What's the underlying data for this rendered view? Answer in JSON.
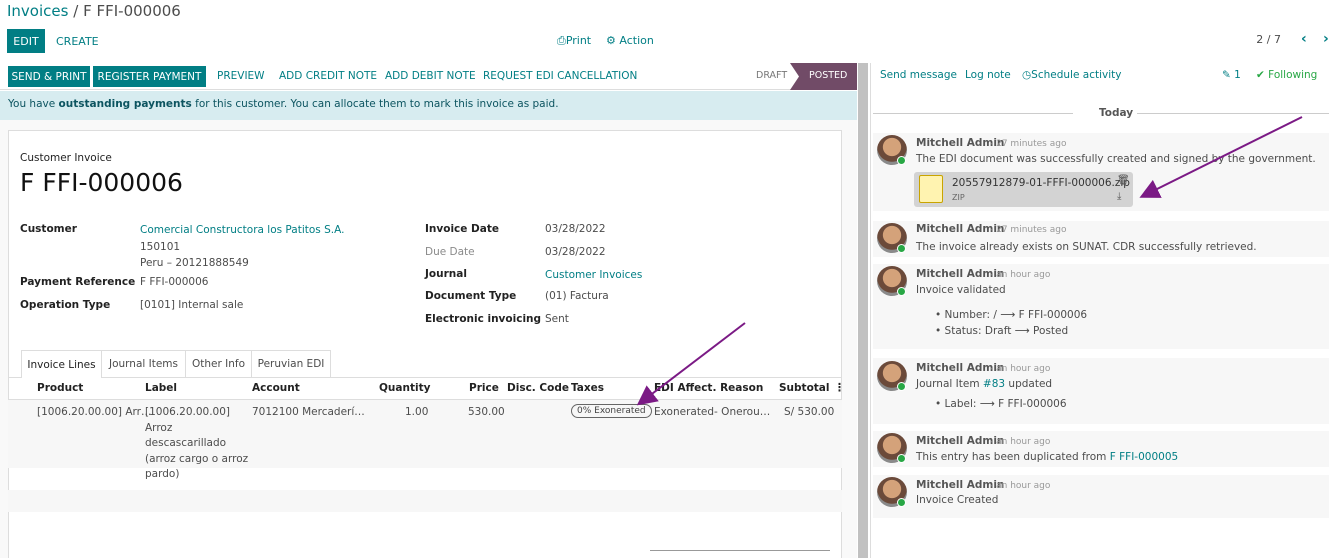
{
  "breadcrumb": {
    "parent": "Invoices",
    "separator": "/",
    "current": "F FFI-000006"
  },
  "toolbar": {
    "edit": "EDIT",
    "create": "CREATE",
    "print": "Print",
    "action": "Action",
    "pager": "2 / 7"
  },
  "actions": {
    "send_print": "SEND & PRINT",
    "register_payment": "REGISTER PAYMENT",
    "preview": "PREVIEW",
    "add_credit_note": "ADD CREDIT NOTE",
    "add_debit_note": "ADD DEBIT NOTE",
    "request_edi_cancel": "REQUEST EDI CANCELLATION"
  },
  "status": {
    "draft": "DRAFT",
    "posted": "POSTED"
  },
  "alert": {
    "prefix": "You have ",
    "bold": "outstanding payments",
    "suffix": " for this customer. You can allocate them to mark this invoice as paid."
  },
  "invoice": {
    "type": "Customer Invoice",
    "number": "F FFI-000006",
    "customer_label": "Customer",
    "customer_name": "Comercial Constructora los Patitos S.A.",
    "customer_line2": "150101",
    "customer_line3": "Peru – 20121888549",
    "payment_ref_label": "Payment Reference",
    "payment_ref": "F FFI-000006",
    "operation_type_label": "Operation Type",
    "operation_type": "[0101] Internal sale",
    "invoice_date_label": "Invoice Date",
    "invoice_date": "03/28/2022",
    "due_date_label": "Due Date",
    "due_date": "03/28/2022",
    "journal_label": "Journal",
    "journal": "Customer Invoices",
    "doc_type_label": "Document Type",
    "doc_type": "(01) Factura",
    "einvoicing_label": "Electronic invoicing",
    "einvoicing": "Sent"
  },
  "tabs": [
    "Invoice Lines",
    "Journal Items",
    "Other Info",
    "Peruvian EDI"
  ],
  "lines": {
    "headers": {
      "product": "Product",
      "label": "Label",
      "account": "Account",
      "quantity": "Quantity",
      "price": "Price",
      "disc": "Disc. Code",
      "taxes": "Taxes",
      "edi": "EDI Affect. Reason",
      "subtotal": "Subtotal"
    },
    "row": {
      "product": "[1006.20.00.00] Arr…",
      "label1": "[1006.20.00.00] Arroz",
      "label2": "descascarillado",
      "label3": "(arroz cargo o arroz",
      "label4": "pardo)",
      "account": "7012100 Mercaderí…",
      "quantity": "1.00",
      "price": "530.00",
      "tax": "0% Exonerated",
      "edi": "Exonerated- Onerou…",
      "subtotal": "S/ 530.00"
    }
  },
  "chatter": {
    "send_message": "Send message",
    "log_note": "Log note",
    "schedule": "Schedule activity",
    "attachments": "1",
    "following": "Following",
    "today": "Today",
    "messages": [
      {
        "author": "Mitchell Admin",
        "time": "- 27 minutes ago",
        "text": "The EDI document was successfully created and signed by the government.",
        "file": "20557912879-01-FFFI-000006.zip",
        "file_type": "ZIP"
      },
      {
        "author": "Mitchell Admin",
        "time": "- 27 minutes ago",
        "text": "The invoice already exists on SUNAT. CDR successfully retrieved."
      },
      {
        "author": "Mitchell Admin",
        "time": "- an hour ago",
        "text": "Invoice validated",
        "b1": "Number: / ⟶ F FFI-000006",
        "b2": "Status: Draft ⟶ Posted"
      },
      {
        "author": "Mitchell Admin",
        "time": "- an hour ago",
        "text_prefix": "Journal Item ",
        "link": "#83",
        "text_suffix": " updated",
        "b1": "Label: ⟶ F FFI-000006"
      },
      {
        "author": "Mitchell Admin",
        "time": "- an hour ago",
        "text_prefix": "This entry has been duplicated from ",
        "link": "F FFI-000005"
      },
      {
        "author": "Mitchell Admin",
        "time": "- an hour ago",
        "text": "Invoice Created"
      }
    ]
  },
  "colors": {
    "accent": "#017e84",
    "posted": "#714b67",
    "annotation_arrow": "#7b1a85"
  }
}
